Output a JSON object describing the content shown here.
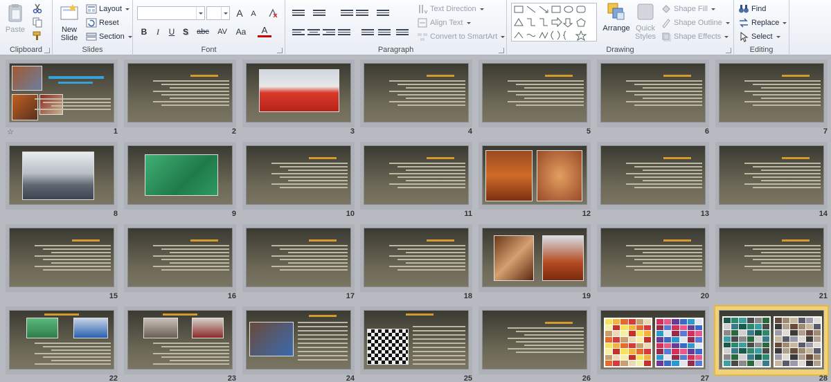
{
  "clipboard": {
    "paste": "Paste",
    "label": "Clipboard"
  },
  "slides_group": {
    "new_slide": "New Slide",
    "layout": "Layout",
    "reset": "Reset",
    "section": "Section",
    "label": "Slides"
  },
  "font": {
    "label": "Font",
    "bold": "B",
    "italic": "I",
    "underline": "U",
    "shadow": "S",
    "strike": "abc",
    "spacing": "AV",
    "case": "Aa",
    "color": "A",
    "grow": "A",
    "shrink": "A"
  },
  "paragraph": {
    "label": "Paragraph",
    "text_direction": "Text Direction",
    "align_text": "Align Text",
    "convert": "Convert to SmartArt"
  },
  "drawing": {
    "label": "Drawing",
    "arrange": "Arrange",
    "quick_styles": "Quick Styles",
    "shape_fill": "Shape Fill",
    "shape_outline": "Shape Outline",
    "shape_effects": "Shape Effects"
  },
  "editing": {
    "label": "Editing",
    "find": "Find",
    "replace": "Replace",
    "select": "Select"
  },
  "colors": {
    "slide_bg_top": "#3b3a32",
    "slide_bg_bottom": "#7a7562",
    "accent": "#d39a2c",
    "selection": "#f1d27a"
  },
  "slides": [
    {
      "num": "1",
      "type": "title-photos"
    },
    {
      "num": "2",
      "type": "text"
    },
    {
      "num": "3",
      "type": "photo-red"
    },
    {
      "num": "4",
      "type": "text"
    },
    {
      "num": "5",
      "type": "text"
    },
    {
      "num": "6",
      "type": "text"
    },
    {
      "num": "7",
      "type": "text"
    },
    {
      "num": "8",
      "type": "photo-hall"
    },
    {
      "num": "9",
      "type": "photo-green"
    },
    {
      "num": "10",
      "type": "text"
    },
    {
      "num": "11",
      "type": "text"
    },
    {
      "num": "12",
      "type": "photo-orange"
    },
    {
      "num": "13",
      "type": "text"
    },
    {
      "num": "14",
      "type": "text"
    },
    {
      "num": "15",
      "type": "text"
    },
    {
      "num": "16",
      "type": "text"
    },
    {
      "num": "17",
      "type": "text"
    },
    {
      "num": "18",
      "type": "text"
    },
    {
      "num": "19",
      "type": "photo-stairs"
    },
    {
      "num": "20",
      "type": "text"
    },
    {
      "num": "21",
      "type": "text"
    },
    {
      "num": "22",
      "type": "photo-text-green"
    },
    {
      "num": "23",
      "type": "photo-text-gray"
    },
    {
      "num": "24",
      "type": "photo-left"
    },
    {
      "num": "25",
      "type": "photo-checker"
    },
    {
      "num": "26",
      "type": "text"
    },
    {
      "num": "27",
      "type": "color-chart"
    },
    {
      "num": "28",
      "type": "color-chart-2",
      "selected": true
    }
  ]
}
